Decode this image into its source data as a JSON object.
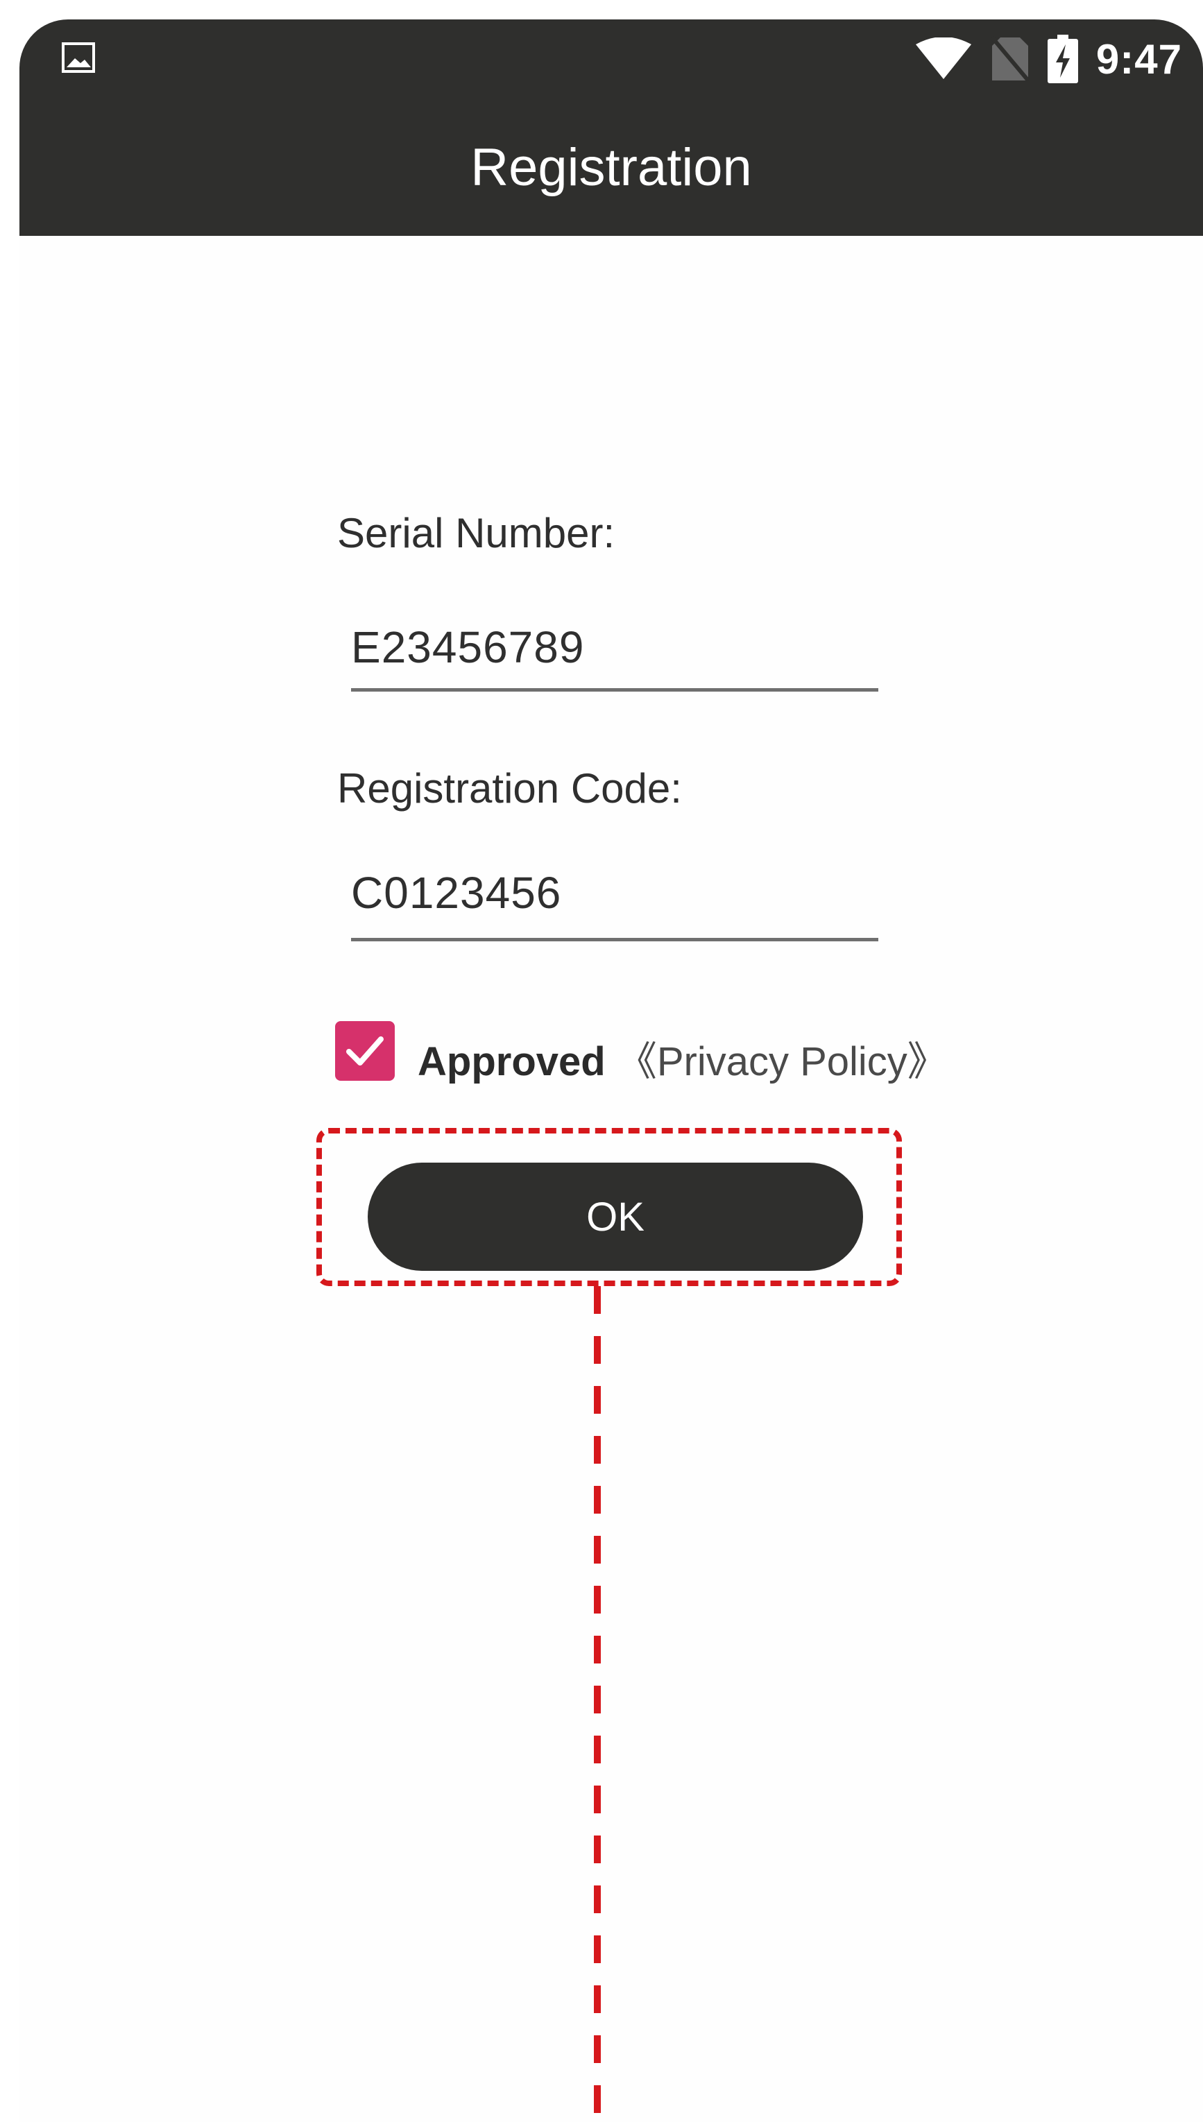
{
  "status_bar": {
    "time": "9:47",
    "left_icon": "image-icon",
    "right_icons": [
      "wifi-icon",
      "no-sim-icon",
      "battery-charging-icon"
    ]
  },
  "app_bar": {
    "title": "Registration"
  },
  "form": {
    "serial_label": "Serial Number:",
    "serial_value": "E23456789",
    "code_label": "Registration Code:",
    "code_value": "C0123456",
    "agree_checked": true,
    "agree_label": "Approved",
    "policy_link": "《Privacy Policy》",
    "ok_label": "OK"
  },
  "colors": {
    "app_bar": "#2f2f2d",
    "accent": "#d6316b",
    "callout": "#d6181c",
    "background": "#fefefe"
  }
}
